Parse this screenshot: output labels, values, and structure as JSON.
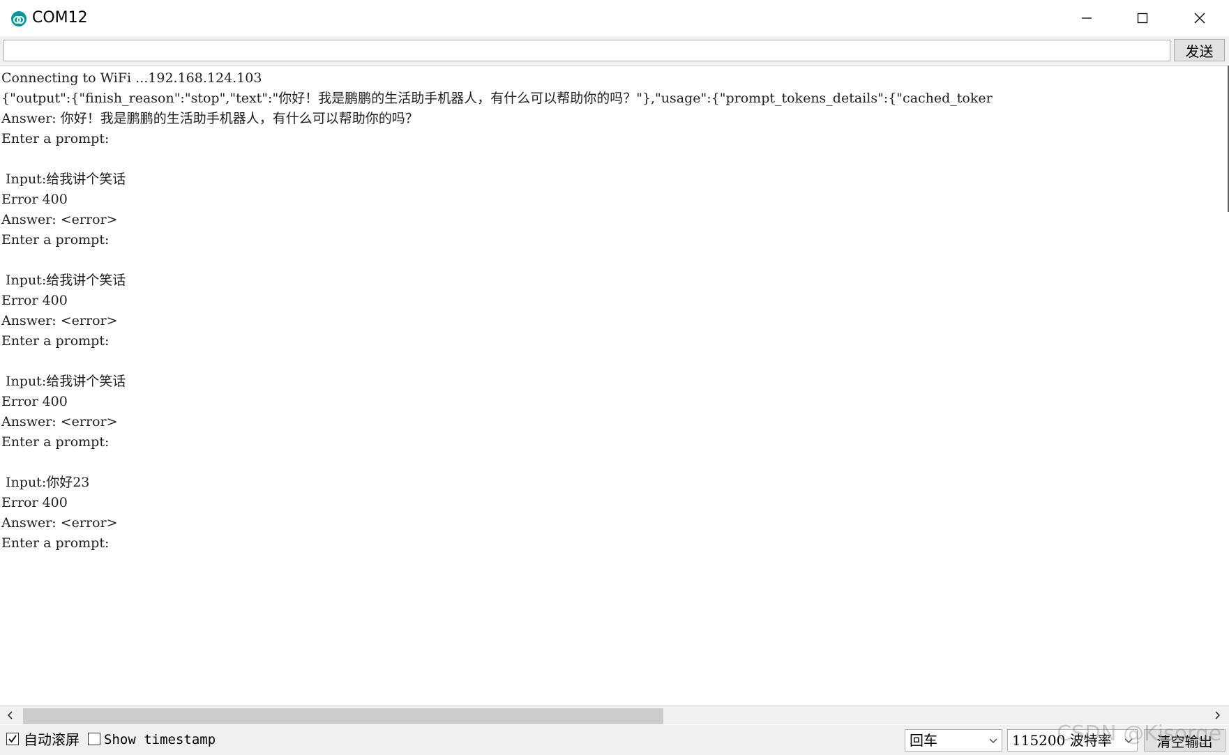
{
  "window": {
    "title": "COM12",
    "icon": "arduino-icon"
  },
  "toolbar": {
    "input_value": "",
    "send_label": "发送"
  },
  "output": {
    "lines": [
      "Connecting to WiFi ...192.168.124.103",
      "{\"output\":{\"finish_reason\":\"stop\",\"text\":\"你好！我是鹏鹏的生活助手机器人，有什么可以帮助你的吗？\"},\"usage\":{\"prompt_tokens_details\":{\"cached_toker",
      "Answer: 你好！我是鹏鹏的生活助手机器人，有什么可以帮助你的吗？",
      "Enter a prompt:",
      "",
      " Input:给我讲个笑话",
      "Error 400",
      "Answer: <error>",
      "Enter a prompt:",
      "",
      " Input:给我讲个笑话",
      "Error 400",
      "Answer: <error>",
      "Enter a prompt:",
      "",
      " Input:给我讲个笑话",
      "Error 400",
      "Answer: <error>",
      "Enter a prompt:",
      "",
      " Input:你好23",
      "Error 400",
      "Answer: <error>",
      "Enter a prompt:"
    ]
  },
  "status": {
    "autoscroll_label": "自动滚屏",
    "autoscroll_checked": true,
    "timestamp_label": "Show timestamp",
    "timestamp_checked": false,
    "line_ending": "回车",
    "baud_rate": "115200 波特率",
    "clear_label": "清空输出"
  },
  "watermark": "CSDN @Kisorge",
  "colors": {
    "arduino_teal": "#00979c",
    "chrome_gray": "#f0f0f0",
    "scroll_thumb": "#cdcdcd"
  }
}
